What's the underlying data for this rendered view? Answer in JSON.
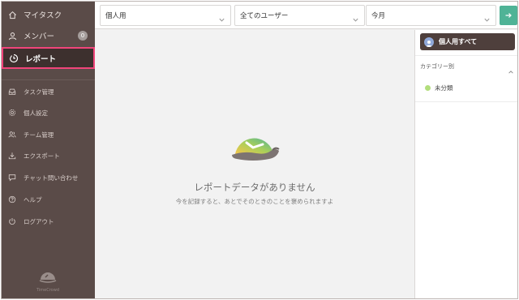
{
  "sidebar": {
    "items": [
      {
        "label": "マイタスク",
        "icon": "home-icon"
      },
      {
        "label": "メンバー",
        "icon": "person-icon",
        "badge": "0"
      },
      {
        "label": "レポート",
        "icon": "report-icon",
        "active": true
      }
    ],
    "sub_items": [
      {
        "label": "タスク管理",
        "icon": "inbox-icon"
      },
      {
        "label": "個人設定",
        "icon": "gear-icon"
      },
      {
        "label": "チーム管理",
        "icon": "team-icon"
      },
      {
        "label": "エクスポート",
        "icon": "download-icon"
      },
      {
        "label": "チャット問い合わせ",
        "icon": "chat-icon"
      },
      {
        "label": "ヘルプ",
        "icon": "help-icon"
      },
      {
        "label": "ログアウト",
        "icon": "power-icon"
      }
    ],
    "brand": "TimeCrowd"
  },
  "filters": {
    "scope": "個人用",
    "users": "全てのユーザー",
    "period": "今月",
    "go_icon": "arrow-right-icon"
  },
  "main": {
    "empty_title": "レポートデータがありません",
    "empty_subtitle": "今を記録すると、あとでそのときのことを褒められますよ"
  },
  "right_panel": {
    "all_button": "個人用すべて",
    "category_heading": "カテゴリー別",
    "categories": [
      {
        "label": "未分類",
        "color": "#b2de7c"
      }
    ]
  },
  "colors": {
    "sidebar": "#5a4b48",
    "active_outline": "#f0457a",
    "accent": "#4fb396"
  }
}
